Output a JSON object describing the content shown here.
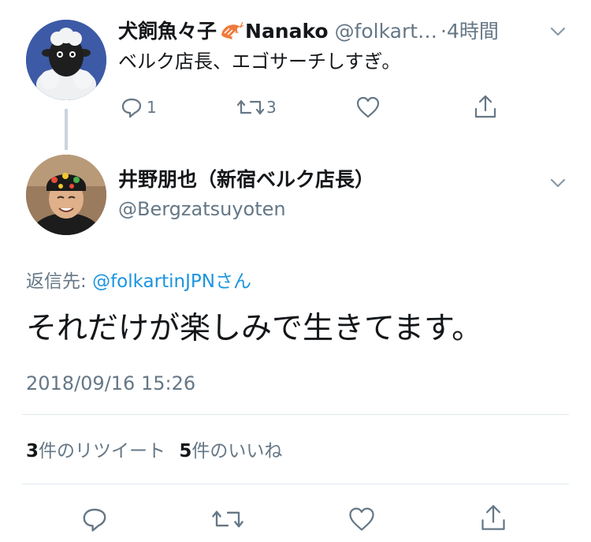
{
  "parent_tweet": {
    "display_name": "犬飼魚々子",
    "name_suffix": "Nanako",
    "handle": "@folkart…",
    "time": "·4時間",
    "text": "ベルク店長、エゴサーチしすぎ。",
    "actions": {
      "reply_count": "1",
      "retweet_count": "3"
    }
  },
  "main_tweet": {
    "display_name": "井野朋也（新宿ベルク店長）",
    "handle": "@Bergzatsuyoten",
    "reply_to_label": "返信先: ",
    "reply_to_handle": "@folkartinJPN",
    "reply_to_suffix": "さん",
    "text": "それだけが楽しみで生きてます。",
    "timestamp": "2018/09/16 15:26"
  },
  "stats": {
    "retweets_count": "3",
    "retweets_label": "件のリツイート",
    "likes_count": "5",
    "likes_label": "件のいいね"
  },
  "colors": {
    "text": "#14171a",
    "secondary": "#657786",
    "link": "#1b95e0",
    "divider": "#e1e8ed"
  }
}
